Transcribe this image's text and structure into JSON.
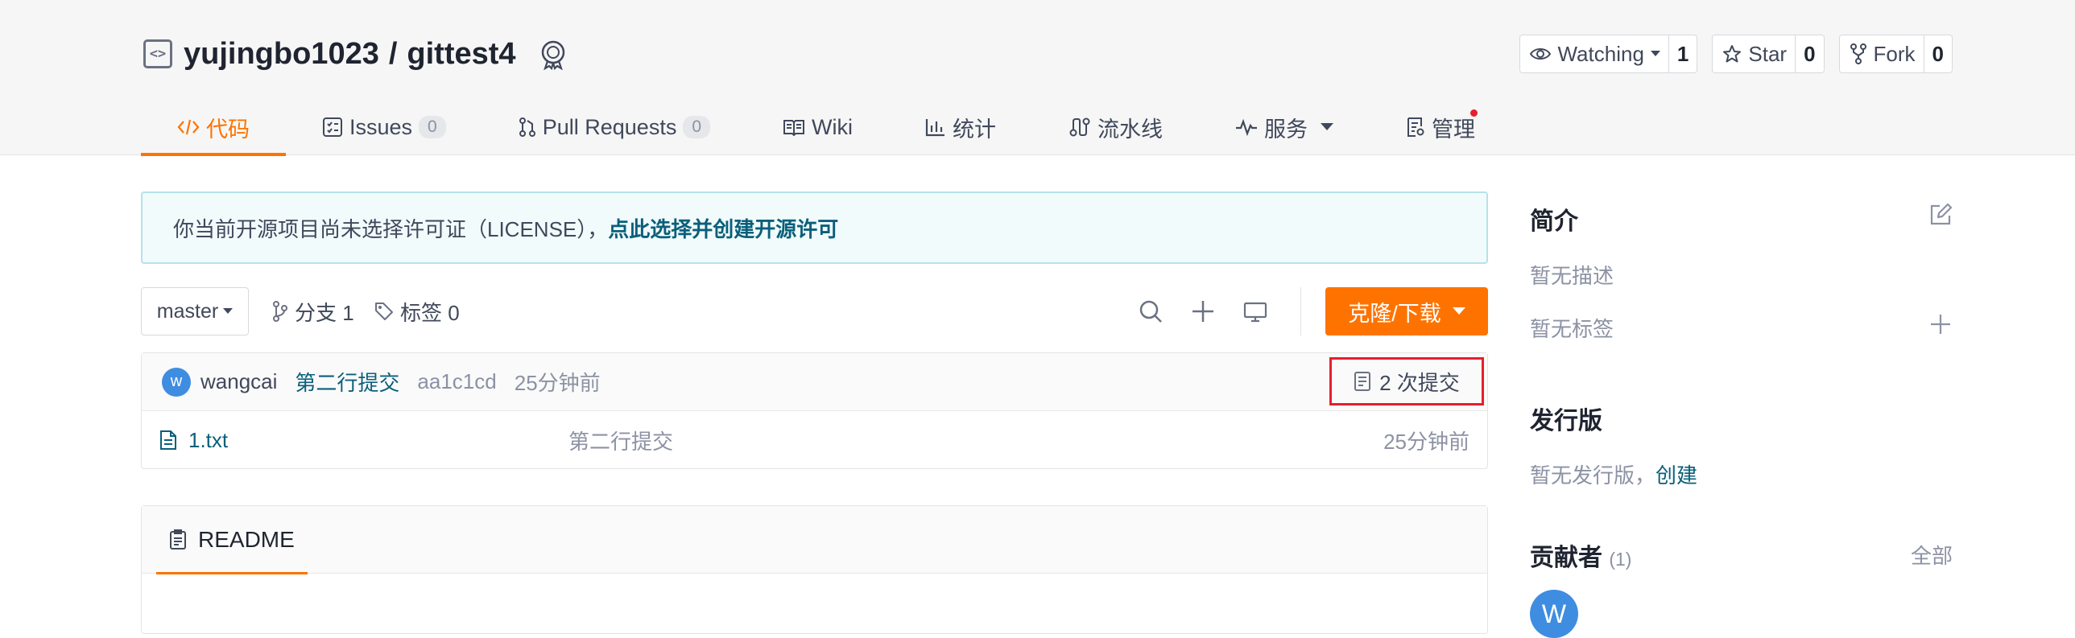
{
  "repo": {
    "owner": "yujingbo1023",
    "separator": "/",
    "name": "gittest4"
  },
  "header_actions": [
    {
      "label": "Watching",
      "count": "1"
    },
    {
      "label": "Star",
      "count": "0"
    },
    {
      "label": "Fork",
      "count": "0"
    }
  ],
  "tabs": [
    {
      "label": "代码",
      "active": true
    },
    {
      "label": "Issues",
      "count": "0"
    },
    {
      "label": "Pull Requests",
      "count": "0"
    },
    {
      "label": "Wiki"
    },
    {
      "label": "统计"
    },
    {
      "label": "流水线"
    },
    {
      "label": "服务"
    },
    {
      "label": "管理"
    }
  ],
  "notice": {
    "text": "你当前开源项目尚未选择许可证（LICENSE），",
    "link": "点此选择并创建开源许可"
  },
  "branch_bar": {
    "branch": "master",
    "branches_label": "分支 1",
    "tags_label": "标签 0",
    "clone_label": "克隆/下载"
  },
  "latest_commit": {
    "avatar_letter": "w",
    "author": "wangcai",
    "message": "第二行提交",
    "sha": "aa1c1cd",
    "time": "25分钟前",
    "count_label": "2 次提交"
  },
  "files": [
    {
      "name": "1.txt",
      "message": "第二行提交",
      "time": "25分钟前"
    }
  ],
  "readme": {
    "title": "README"
  },
  "sidebar": {
    "intro_title": "简介",
    "no_description": "暂无描述",
    "no_tags": "暂无标签",
    "releases_title": "发行版",
    "no_releases": "暂无发行版，",
    "create_link": "创建",
    "contributors_title": "贡献者",
    "contributors_count": "(1)",
    "all_link": "全部",
    "contributor_letter": "W"
  },
  "colors": {
    "accent": "#fe7300",
    "link": "#0a5f7a",
    "notice_bg": "#f1fbfc",
    "highlight_box": "#e51f2e"
  }
}
